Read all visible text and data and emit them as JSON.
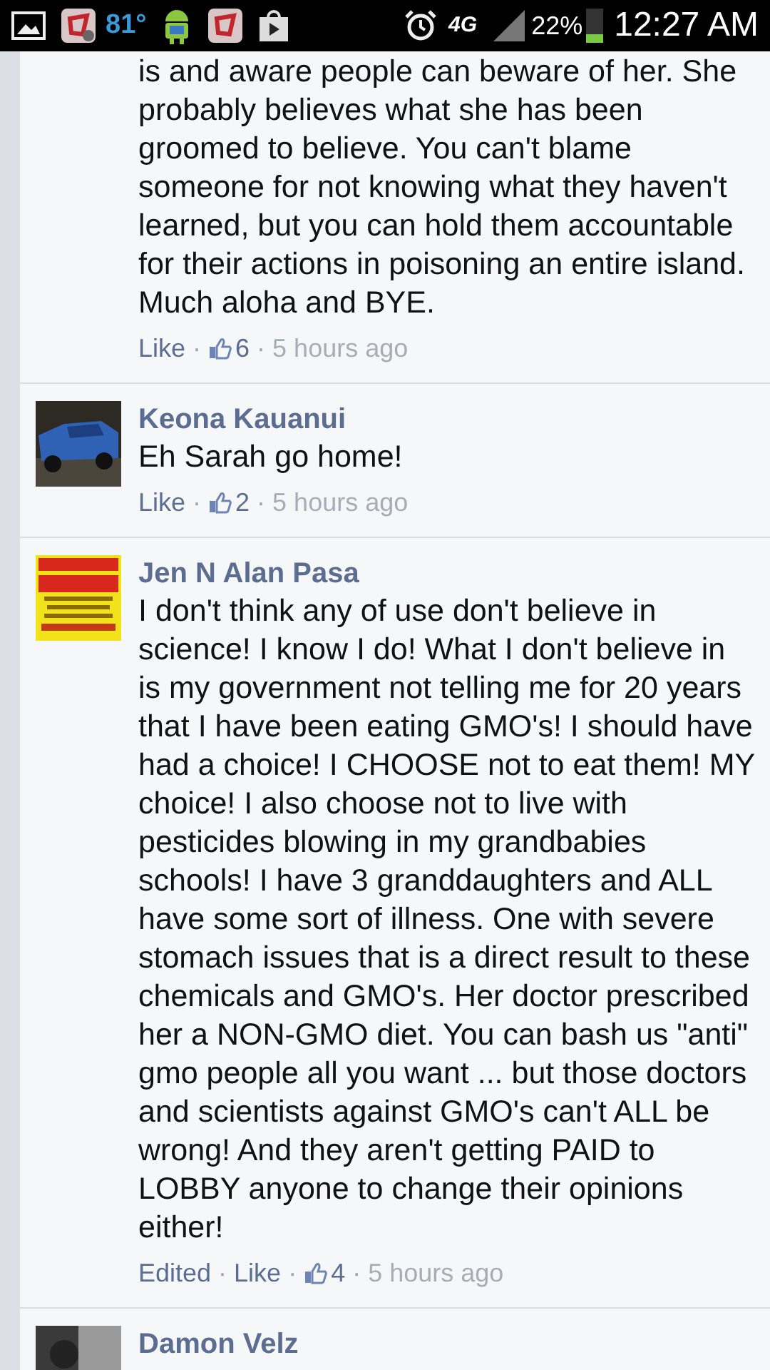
{
  "status_bar": {
    "temperature": "81°",
    "network": "4G",
    "battery": "22%",
    "time": "12:27 AM"
  },
  "comments": [
    {
      "text": "is and aware people can beware of her. She probably believes what she has been groomed to believe. You can't blame someone for not knowing what they haven't learned, but you can hold them accountable for their actions in poisoning an entire island. Much aloha and BYE.",
      "meta": [
        {
          "kind": "link",
          "text": "Like"
        },
        {
          "kind": "sep",
          "text": "·"
        },
        {
          "kind": "likes",
          "text": "6"
        },
        {
          "kind": "sep",
          "text": "·"
        },
        {
          "kind": "time",
          "text": "5 hours ago"
        }
      ]
    },
    {
      "author": "Keona Kauanui",
      "text": "Eh Sarah go home!",
      "meta": [
        {
          "kind": "link",
          "text": "Like"
        },
        {
          "kind": "sep",
          "text": "·"
        },
        {
          "kind": "likes",
          "text": "2"
        },
        {
          "kind": "sep",
          "text": "·"
        },
        {
          "kind": "time",
          "text": "5 hours ago"
        }
      ]
    },
    {
      "author": "Jen N Alan Pasa",
      "text": "I don't think any of use don't believe in science! I know I do! What I don't believe in is my government not telling me for 20 years that I have been eating GMO's! I should have had a choice! I CHOOSE not to eat them! MY choice! I also choose not to live with pesticides blowing in my grandbabies schools! I have 3 granddaughters and ALL have some sort of illness. One with severe stomach issues that is a direct result to these chemicals and GMO's. Her doctor prescribed her a NON-GMO diet. You can bash us \"anti\" gmo people all you want ... but those doctors and scientists against GMO's can't ALL be wrong! And they aren't getting PAID to LOBBY anyone to change their opinions either!",
      "meta": [
        {
          "kind": "link",
          "text": "Edited"
        },
        {
          "kind": "sep",
          "text": "·"
        },
        {
          "kind": "link",
          "text": "Like"
        },
        {
          "kind": "sep",
          "text": "·"
        },
        {
          "kind": "likes",
          "text": "4"
        },
        {
          "kind": "sep",
          "text": "·"
        },
        {
          "kind": "time",
          "text": "5 hours ago"
        }
      ]
    },
    {
      "author": "Damon Velz"
    }
  ]
}
